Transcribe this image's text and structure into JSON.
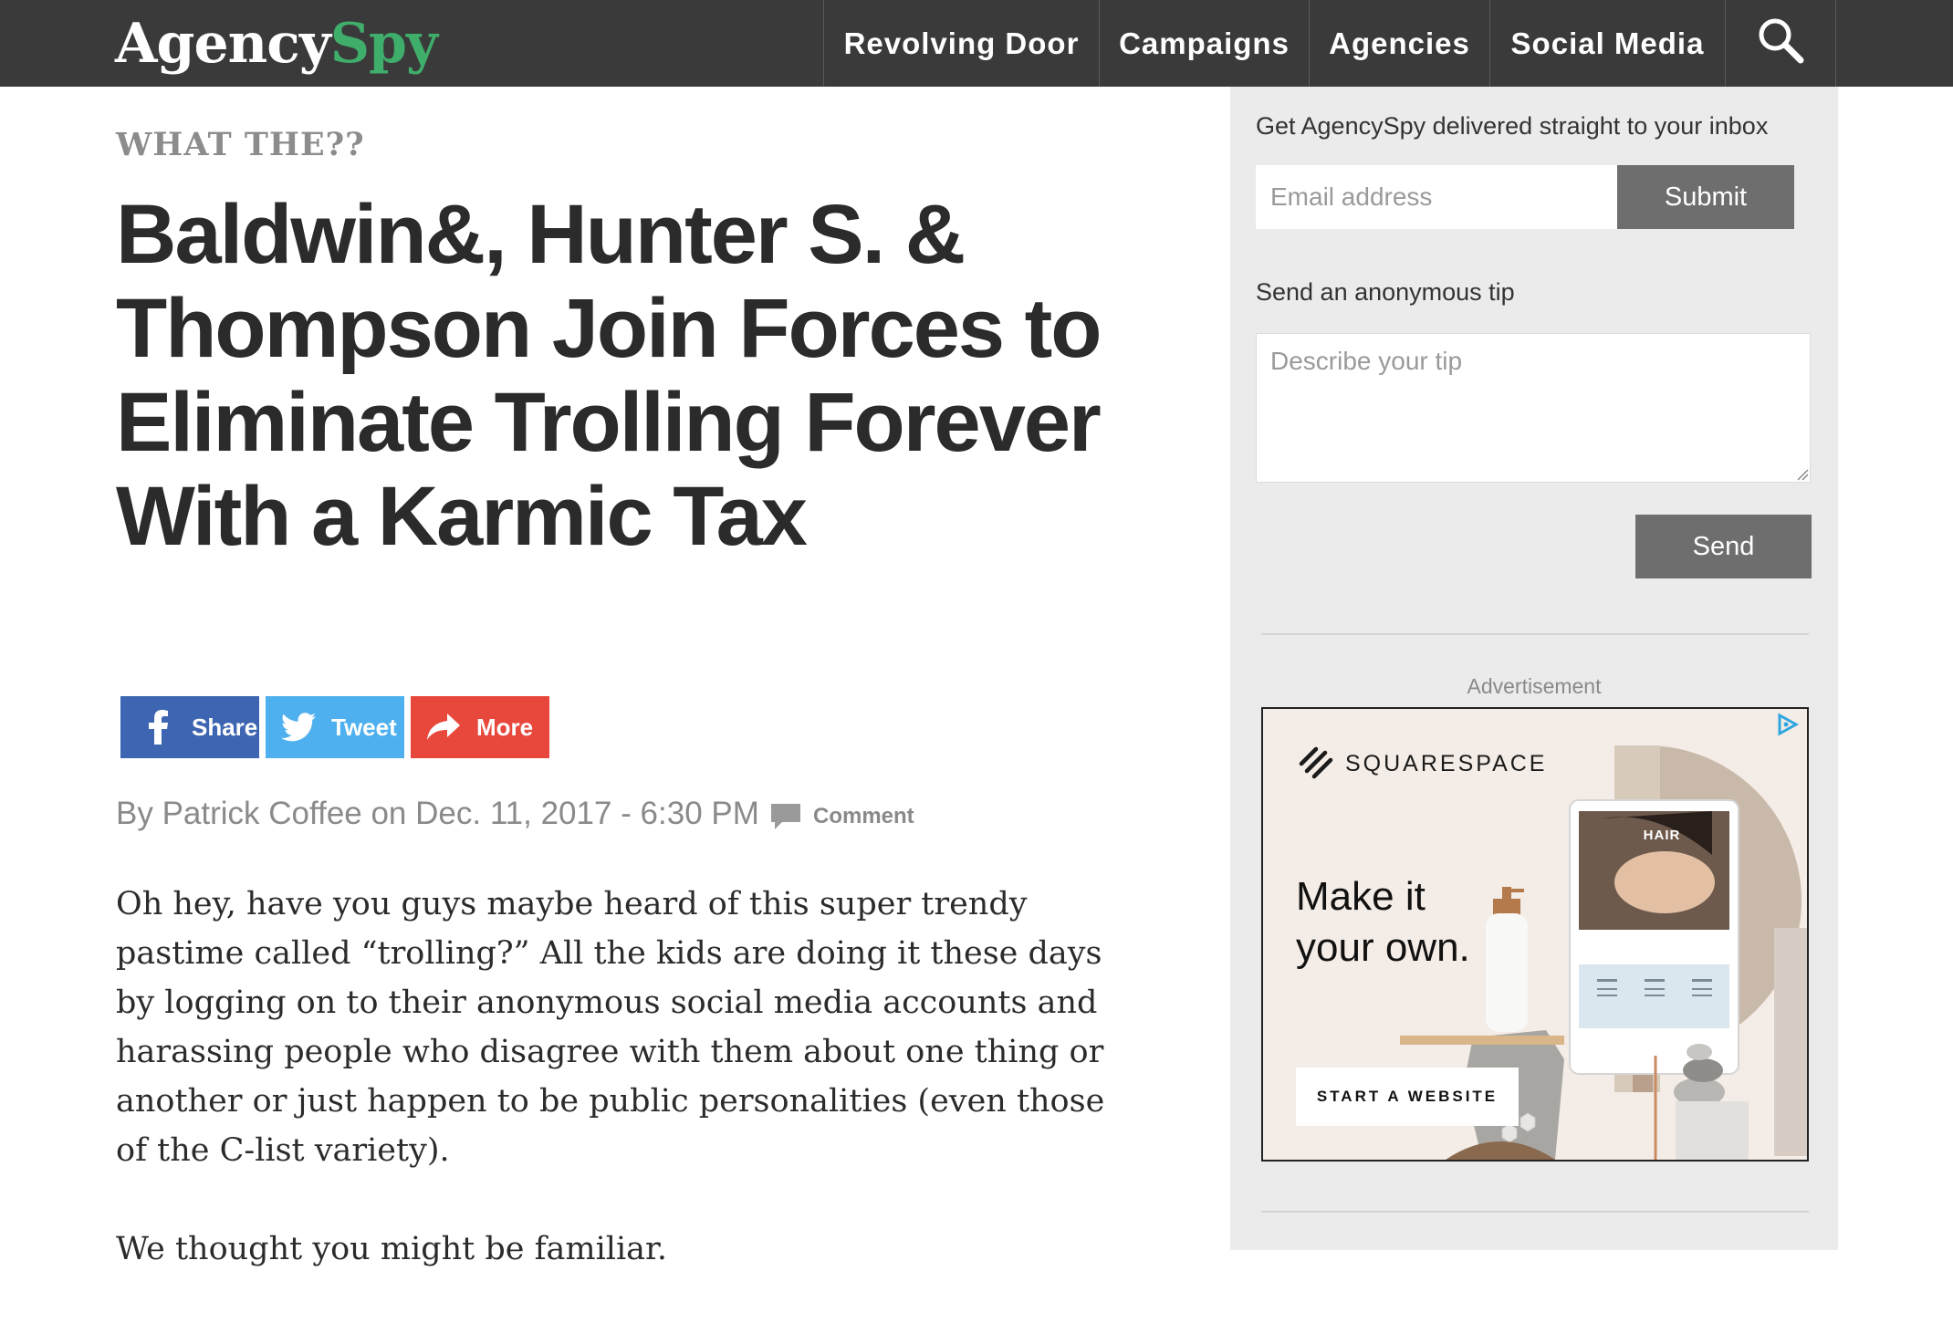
{
  "brand": {
    "part1": "Agency",
    "part2": "Spy"
  },
  "nav": {
    "items": [
      {
        "label": "Revolving Door"
      },
      {
        "label": "Campaigns"
      },
      {
        "label": "Agencies"
      },
      {
        "label": "Social Media"
      }
    ],
    "search_icon": "search-icon"
  },
  "article": {
    "kicker": "WHAT THE??",
    "headline": "Baldwin&, Hunter S. & Thompson Join Forces to Eliminate Trolling Forever With a Karmic Tax",
    "share": {
      "facebook": "Share",
      "twitter": "Tweet",
      "more": "More"
    },
    "byline": "By Patrick Coffee on Dec. 11, 2017 - 6:30 PM",
    "comment_label": "Comment",
    "paragraphs": [
      "Oh hey, have you guys maybe heard of this super trendy pastime called “trolling?” All the kids are doing it these days by logging on to their anonymous social media accounts and harassing people who disagree with them about one thing or another or just happen to be public personalities (even those of the C-list variety).",
      "We thought you might be familiar."
    ]
  },
  "sidebar": {
    "newsletter_label": "Get AgencySpy delivered straight to your inbox",
    "email_placeholder": "Email address",
    "submit_label": "Submit",
    "tip_label": "Send an anonymous tip",
    "tip_placeholder": "Describe your tip",
    "send_label": "Send",
    "ad_label": "Advertisement"
  },
  "ad": {
    "brand": "SQUARESPACE",
    "tagline_line1": "Make it",
    "tagline_line2": "your own.",
    "cta": "START A WEBSITE",
    "tablet_title": "HAIR"
  },
  "colors": {
    "nav_bg": "#3a3a3a",
    "brand_green": "#3fae6a",
    "facebook": "#3d65b1",
    "twitter": "#4fb0ef",
    "more": "#e8473c",
    "sidebar_bg": "#ebebeb",
    "button_gray": "#6e6e6e"
  }
}
